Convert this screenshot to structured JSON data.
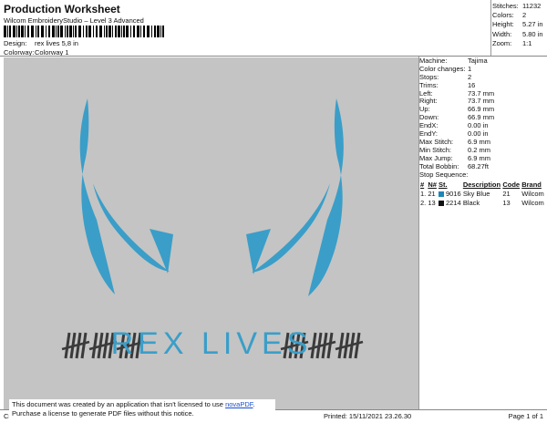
{
  "header": {
    "title": "Production Worksheet",
    "subtitle": "Wilcom EmbroideryStudio – Level 3 Advanced",
    "design_label": "Design:",
    "design_value": "rex lives 5,8 in",
    "colorway_label": "Colorway:",
    "colorway_value": "Colorway 1"
  },
  "top_stats": [
    {
      "label": "Stitches:",
      "value": "11232"
    },
    {
      "label": "Colors:",
      "value": "2"
    },
    {
      "label": "Height:",
      "value": "5.27 in"
    },
    {
      "label": "Width:",
      "value": "5.80 in"
    },
    {
      "label": "Zoom:",
      "value": "1:1"
    }
  ],
  "machine_info": [
    {
      "label": "Machine:",
      "value": "Tajima"
    },
    {
      "label": "Color changes:",
      "value": "1"
    },
    {
      "label": "Stops:",
      "value": "2"
    },
    {
      "label": "Trims:",
      "value": "16"
    },
    {
      "label": "Left:",
      "value": "73.7 mm"
    },
    {
      "label": "Right:",
      "value": "73.7 mm"
    },
    {
      "label": "Up:",
      "value": "66.9 mm"
    },
    {
      "label": "Down:",
      "value": "66.9 mm"
    },
    {
      "label": "EndX:",
      "value": "0.00 in"
    },
    {
      "label": "EndY:",
      "value": "0.00 in"
    },
    {
      "label": "Max Stitch:",
      "value": "6.9 mm"
    },
    {
      "label": "Min Stitch:",
      "value": "0.2 mm"
    },
    {
      "label": "Max Jump:",
      "value": "6.9 mm"
    },
    {
      "label": "Total Bobbin:",
      "value": "68.27ft"
    }
  ],
  "stop_sequence": {
    "title": "Stop Sequence:",
    "headers": [
      "#",
      "N#",
      "St.",
      "Description",
      "Code",
      "Brand"
    ],
    "rows": [
      {
        "num": "1.",
        "n": "21",
        "st": "9016",
        "color": "#1e86b8",
        "desc": "Sky Blue",
        "code": "21",
        "brand": "Wilcom"
      },
      {
        "num": "2.",
        "n": "13",
        "st": "2214",
        "color": "#111111",
        "desc": "Black",
        "code": "13",
        "brand": "Wilcom"
      }
    ]
  },
  "design": {
    "text": "REX LIVES",
    "primary_color": "#3a9ec8",
    "stripe_color": "#3a3a3a"
  },
  "notice": {
    "line1_prefix": "This document was created by an application that isn't licensed to use ",
    "link": "novaPDF",
    "line1_suffix": ".",
    "line2": "Purchase a license to generate PDF files without this notice."
  },
  "footer": {
    "cr": "Cr",
    "printed": "Printed: 15/11/2021 23.26.30",
    "page": "Page 1 of 1"
  }
}
